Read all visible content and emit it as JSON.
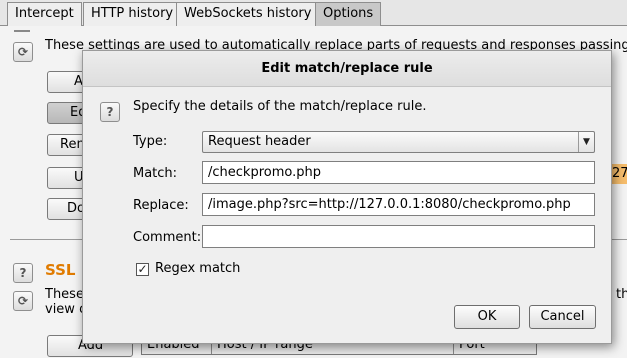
{
  "tabs": [
    {
      "label": "Intercept"
    },
    {
      "label": "HTTP history"
    },
    {
      "label": "WebSockets history"
    },
    {
      "label": "Options",
      "active": true
    }
  ],
  "background": {
    "description": "These settings are used to automatically replace parts of requests and responses passing t",
    "buttons": [
      "Ad",
      "Ed",
      "Rem",
      "U",
      "Do"
    ],
    "orange_value": "27",
    "ssl_section": "SSL P",
    "ssl_text_line1": "These",
    "ssl_text_line1_end": "th",
    "ssl_text_line2": "view o",
    "add_button": "Add",
    "table_headers": [
      "Enabled",
      "Host / IP range",
      "Port"
    ]
  },
  "dialog": {
    "title": "Edit match/replace rule",
    "intro": "Specify the details of the match/replace rule.",
    "type_label": "Type:",
    "type_value": "Request header",
    "match_label": "Match:",
    "match_value": "/checkpromo.php",
    "replace_label": "Replace:",
    "replace_value": "/image.php?src=http://127.0.0.1:8080/checkpromo.php",
    "comment_label": "Comment:",
    "comment_value": "",
    "regex_label": "Regex match",
    "regex_checked": true,
    "ok_label": "OK",
    "cancel_label": "Cancel"
  },
  "icons": {
    "help": "help-icon",
    "refresh": "refresh-icon",
    "dropdown": "chevron-down-icon",
    "check": "checkmark-icon"
  }
}
